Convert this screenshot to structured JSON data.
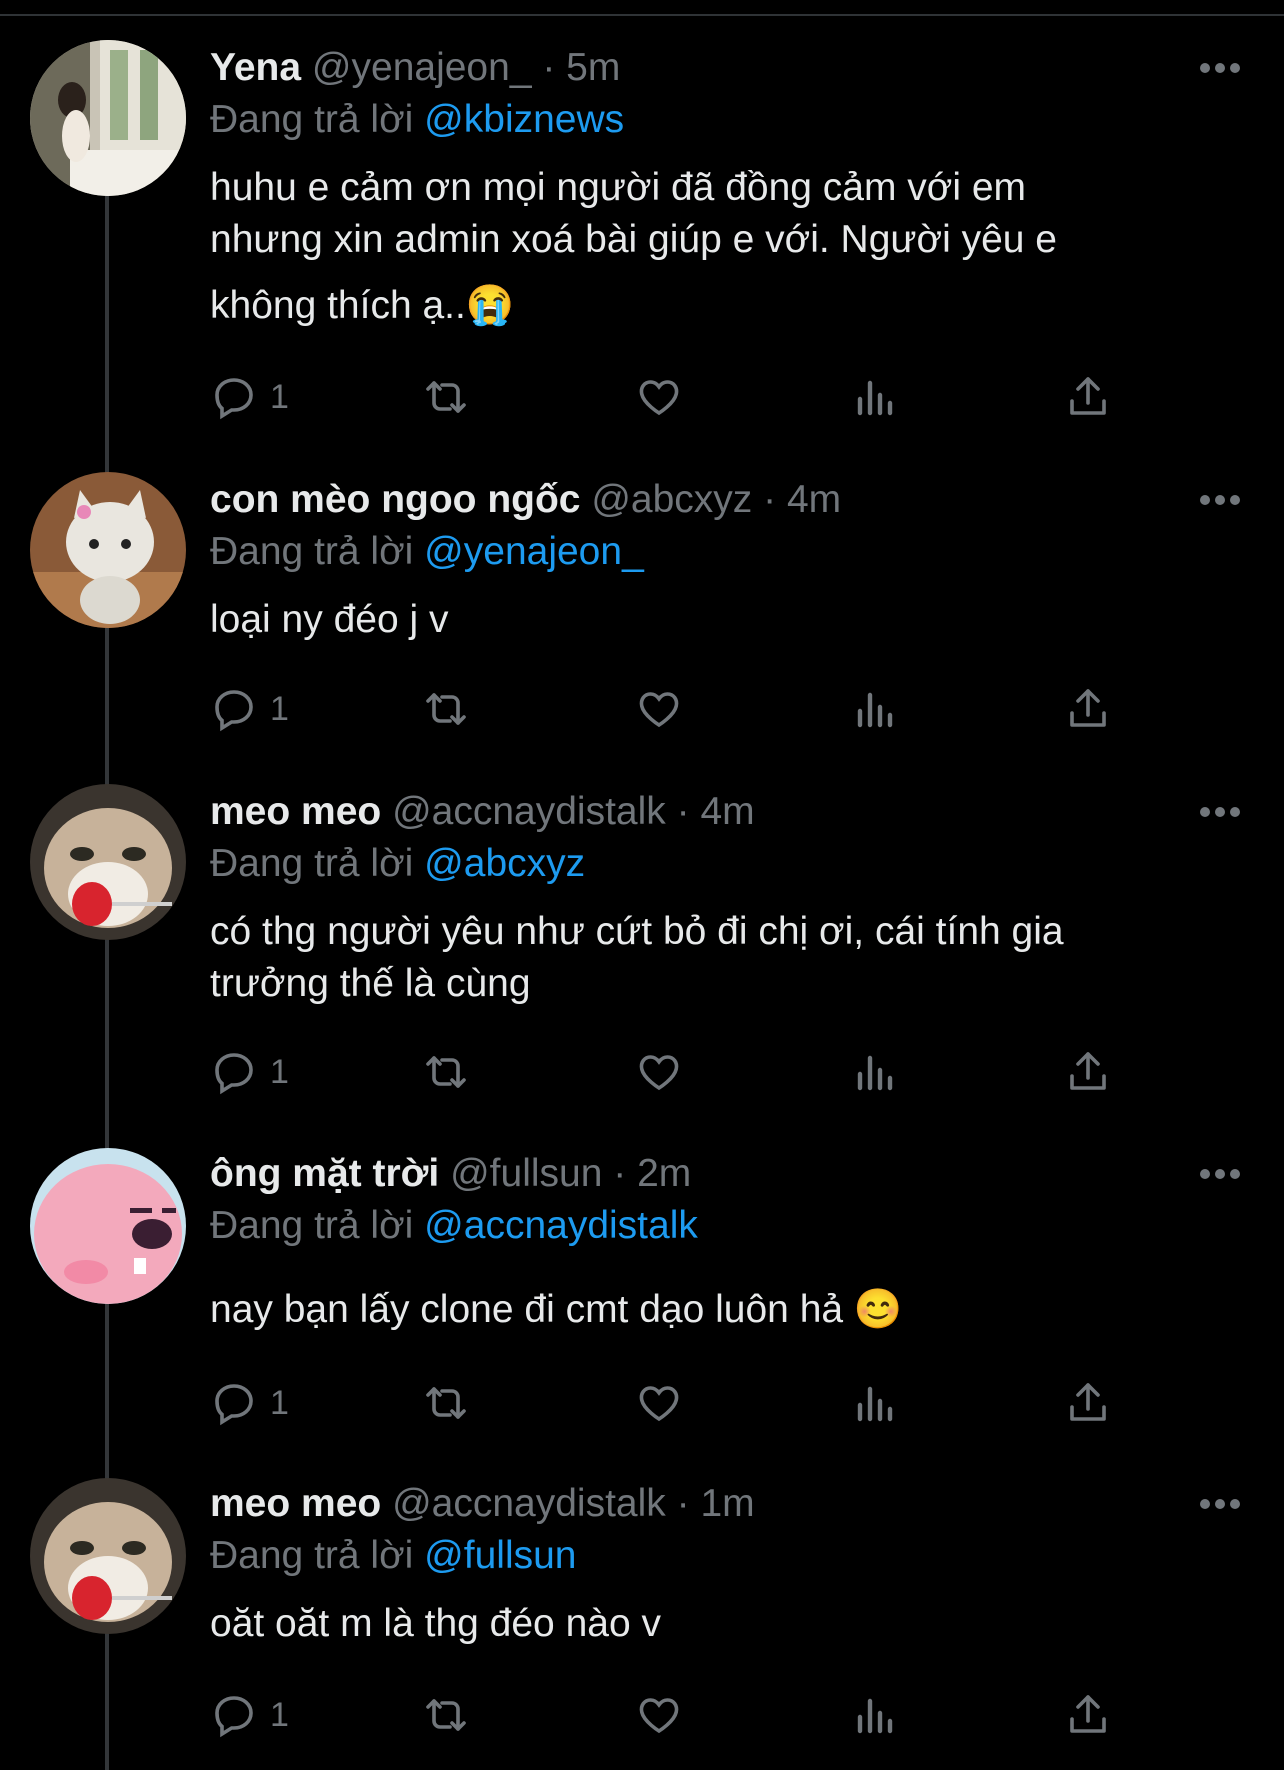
{
  "tweets": [
    {
      "name": "Yena",
      "handle": "@yenajeon_",
      "time": "· 5m",
      "replying_prefix": "Đang trả lời",
      "replying_to": "@kbiznews",
      "text_lines": [
        "huhu e cảm ơn mọi người đã đồng cảm với em",
        "nhưng xin admin xoá bài giúp e với. Người yêu e",
        "không thích ạ..😭"
      ],
      "reply_count": "1"
    },
    {
      "name": "con mèo ngoo ngốc",
      "handle": "@abcxyz",
      "time": "· 4m",
      "replying_prefix": "Đang trả lời",
      "replying_to": "@yenajeon_",
      "text_lines": [
        "loại ny đéo j v"
      ],
      "reply_count": "1"
    },
    {
      "name": "meo meo",
      "handle": "@accnaydistalk",
      "time": "· 4m",
      "replying_prefix": "Đang trả lời",
      "replying_to": "@abcxyz",
      "text_lines": [
        "có thg người yêu như cứt bỏ đi chị ơi, cái tính gia",
        "trưởng thế là cùng"
      ],
      "reply_count": "1"
    },
    {
      "name": "ông mặt trời",
      "handle": "@fullsun",
      "time": "· 2m",
      "replying_prefix": "Đang trả lời",
      "replying_to": "@accnaydistalk",
      "text_lines": [
        "nay bạn lấy clone đi cmt dạo luôn hả 😊"
      ],
      "reply_count": "1"
    },
    {
      "name": "meo meo",
      "handle": "@accnaydistalk",
      "time": "· 1m",
      "replying_prefix": "Đang trả lời",
      "replying_to": "@fullsun",
      "text_lines": [
        "oăt oăt m là thg đéo nào v"
      ],
      "reply_count": "1"
    }
  ],
  "icons": {
    "reply": "reply-icon",
    "retweet": "retweet-icon",
    "like": "heart-icon",
    "views": "views-icon",
    "share": "share-icon",
    "more": "more-icon"
  },
  "colors": {
    "background": "#000000",
    "text": "#e7e9ea",
    "secondary": "#71767b",
    "mention": "#1d9bf0"
  }
}
